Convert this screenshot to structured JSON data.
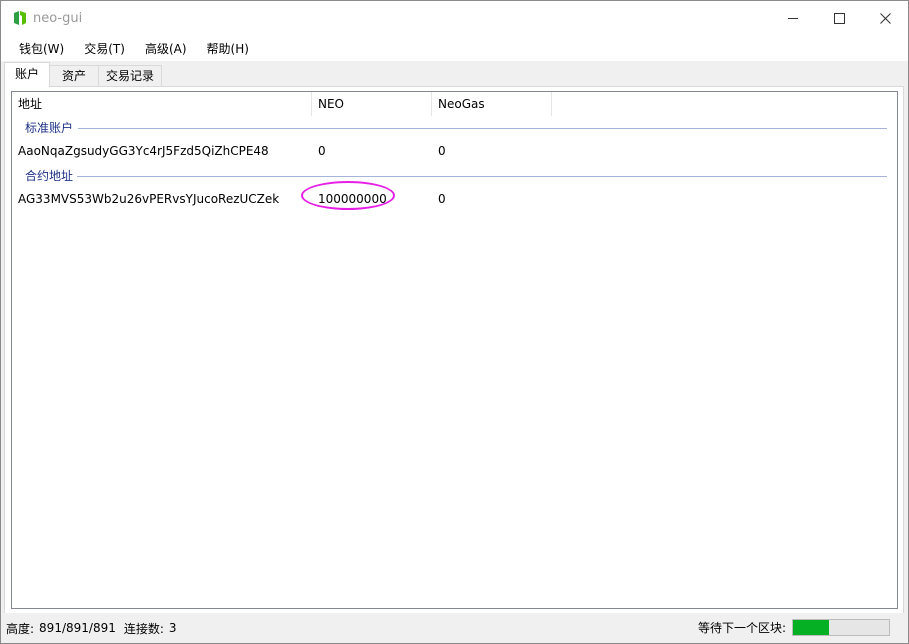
{
  "window": {
    "title": "neo-gui"
  },
  "menu": [
    "钱包(W)",
    "交易(T)",
    "高级(A)",
    "帮助(H)"
  ],
  "tabs": [
    "账户",
    "资产",
    "交易记录"
  ],
  "columns": [
    "地址",
    "NEO",
    "NeoGas"
  ],
  "groups": {
    "standard": "标准账户",
    "contract": "合约地址"
  },
  "rows": [
    {
      "address": "AaoNqaZgsudyGG3Yc4rJ5Fzd5QiZhCPE48",
      "neo": "0",
      "gas": "0"
    },
    {
      "address": "AG33MVS53Wb2u26vPERvsYJucoRezUCZek",
      "neo": "100000000",
      "gas": "0"
    }
  ],
  "status": {
    "height_label": "高度:",
    "height_value": "891/891/891",
    "connections_label": "连接数:",
    "connections_value": "3",
    "waiting_label": "等待下一个区块:",
    "progress_fraction": 0.38
  },
  "colors": {
    "accent_green": "#06b025",
    "group_text": "#1e3287",
    "highlight": "#e61ee6"
  },
  "icons": {
    "app": "neo-logo-icon",
    "minimize": "minimize-icon",
    "maximize": "maximize-icon",
    "close": "close-icon"
  }
}
